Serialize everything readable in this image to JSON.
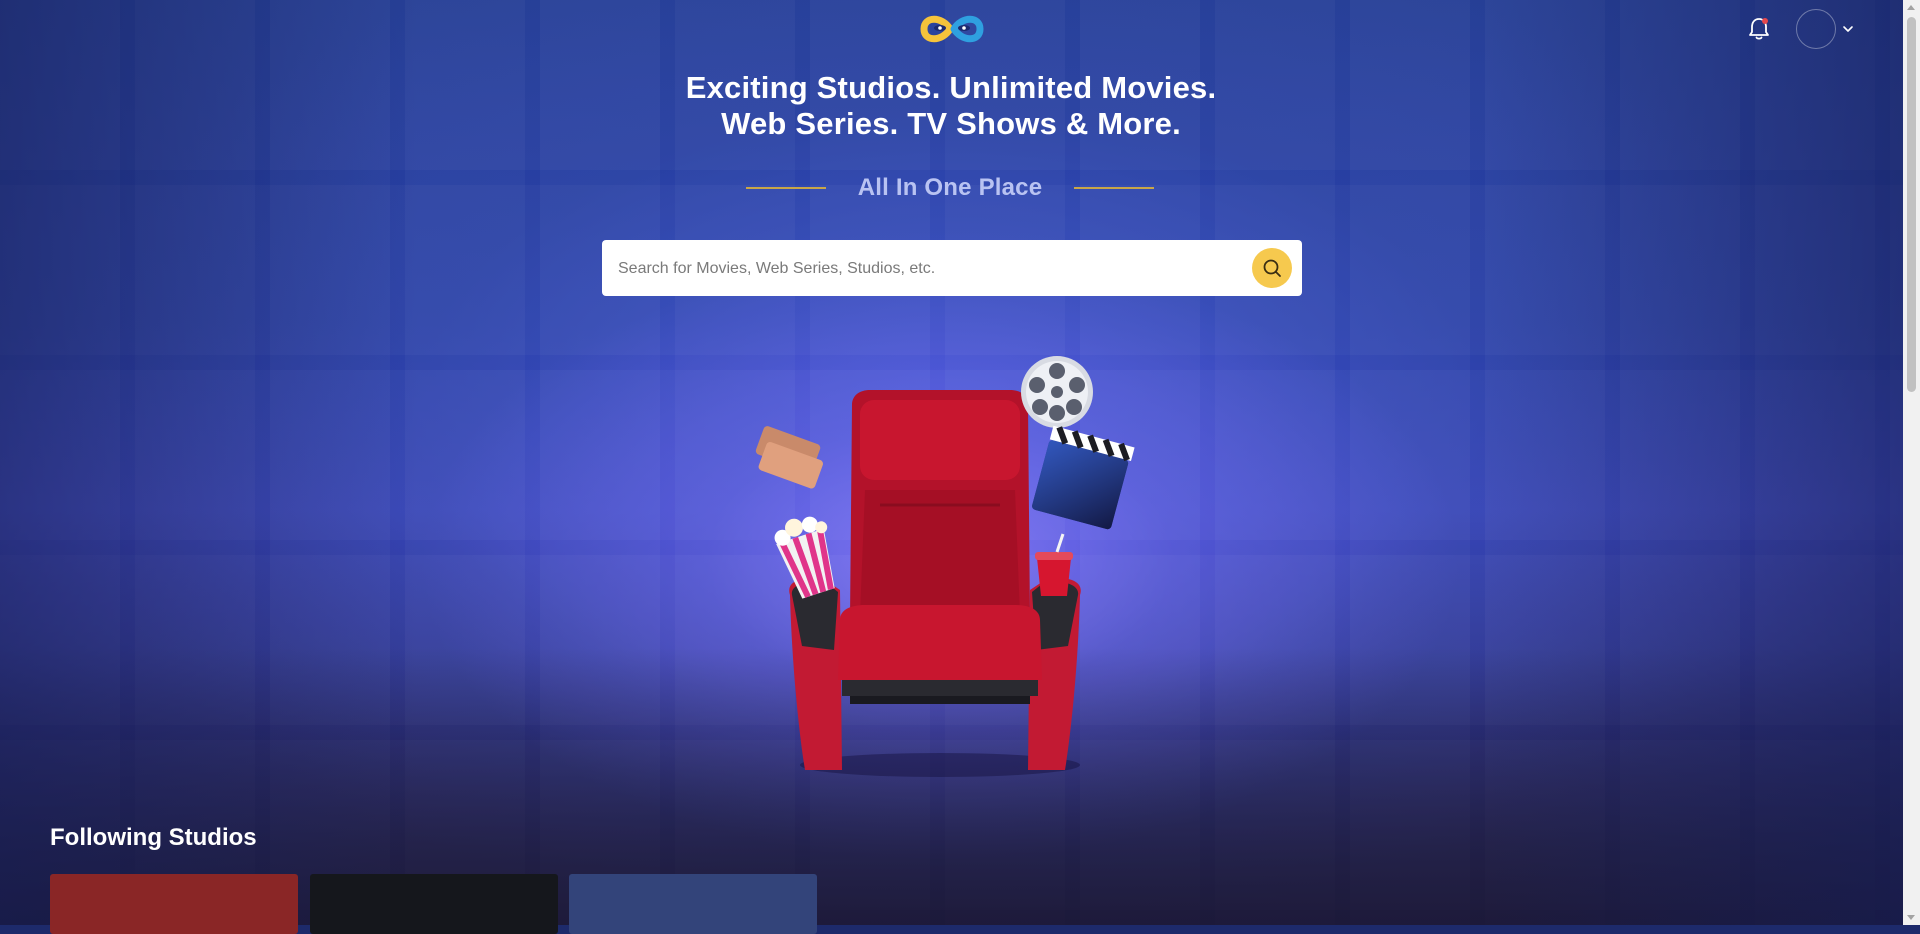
{
  "header": {
    "logo_icon": "infinity-eyes-logo",
    "notification_icon": "bell-icon",
    "avatar_icon": "user-avatar",
    "menu_icon": "chevron-down-icon",
    "colors": {
      "logo_yellow": "#f5c33b",
      "logo_blue": "#2fa0e0",
      "notification_dot": "#e5484d"
    }
  },
  "hero": {
    "headline_line1": "Exciting Studios. Unlimited Movies.",
    "headline_line2": "Web Series. TV Shows & More.",
    "tagline": "All In One Place",
    "accent_color": "#c9a648"
  },
  "search": {
    "placeholder": "Search for Movies, Web Series, Studios, etc.",
    "value": "",
    "button_icon": "search-icon",
    "button_color": "#f6c94e"
  },
  "illustration": {
    "description_icon": "cinema-seat-illustration",
    "items": [
      "ticket-icon",
      "popcorn-icon",
      "film-reel-icon",
      "clapperboard-icon",
      "soda-cup-icon"
    ],
    "seat_color": "#b3122a"
  },
  "following": {
    "title": "Following Studios",
    "cards": [
      {
        "color": "#8a2626"
      },
      {
        "color": "#15171c"
      },
      {
        "color": "#33447a"
      }
    ]
  }
}
